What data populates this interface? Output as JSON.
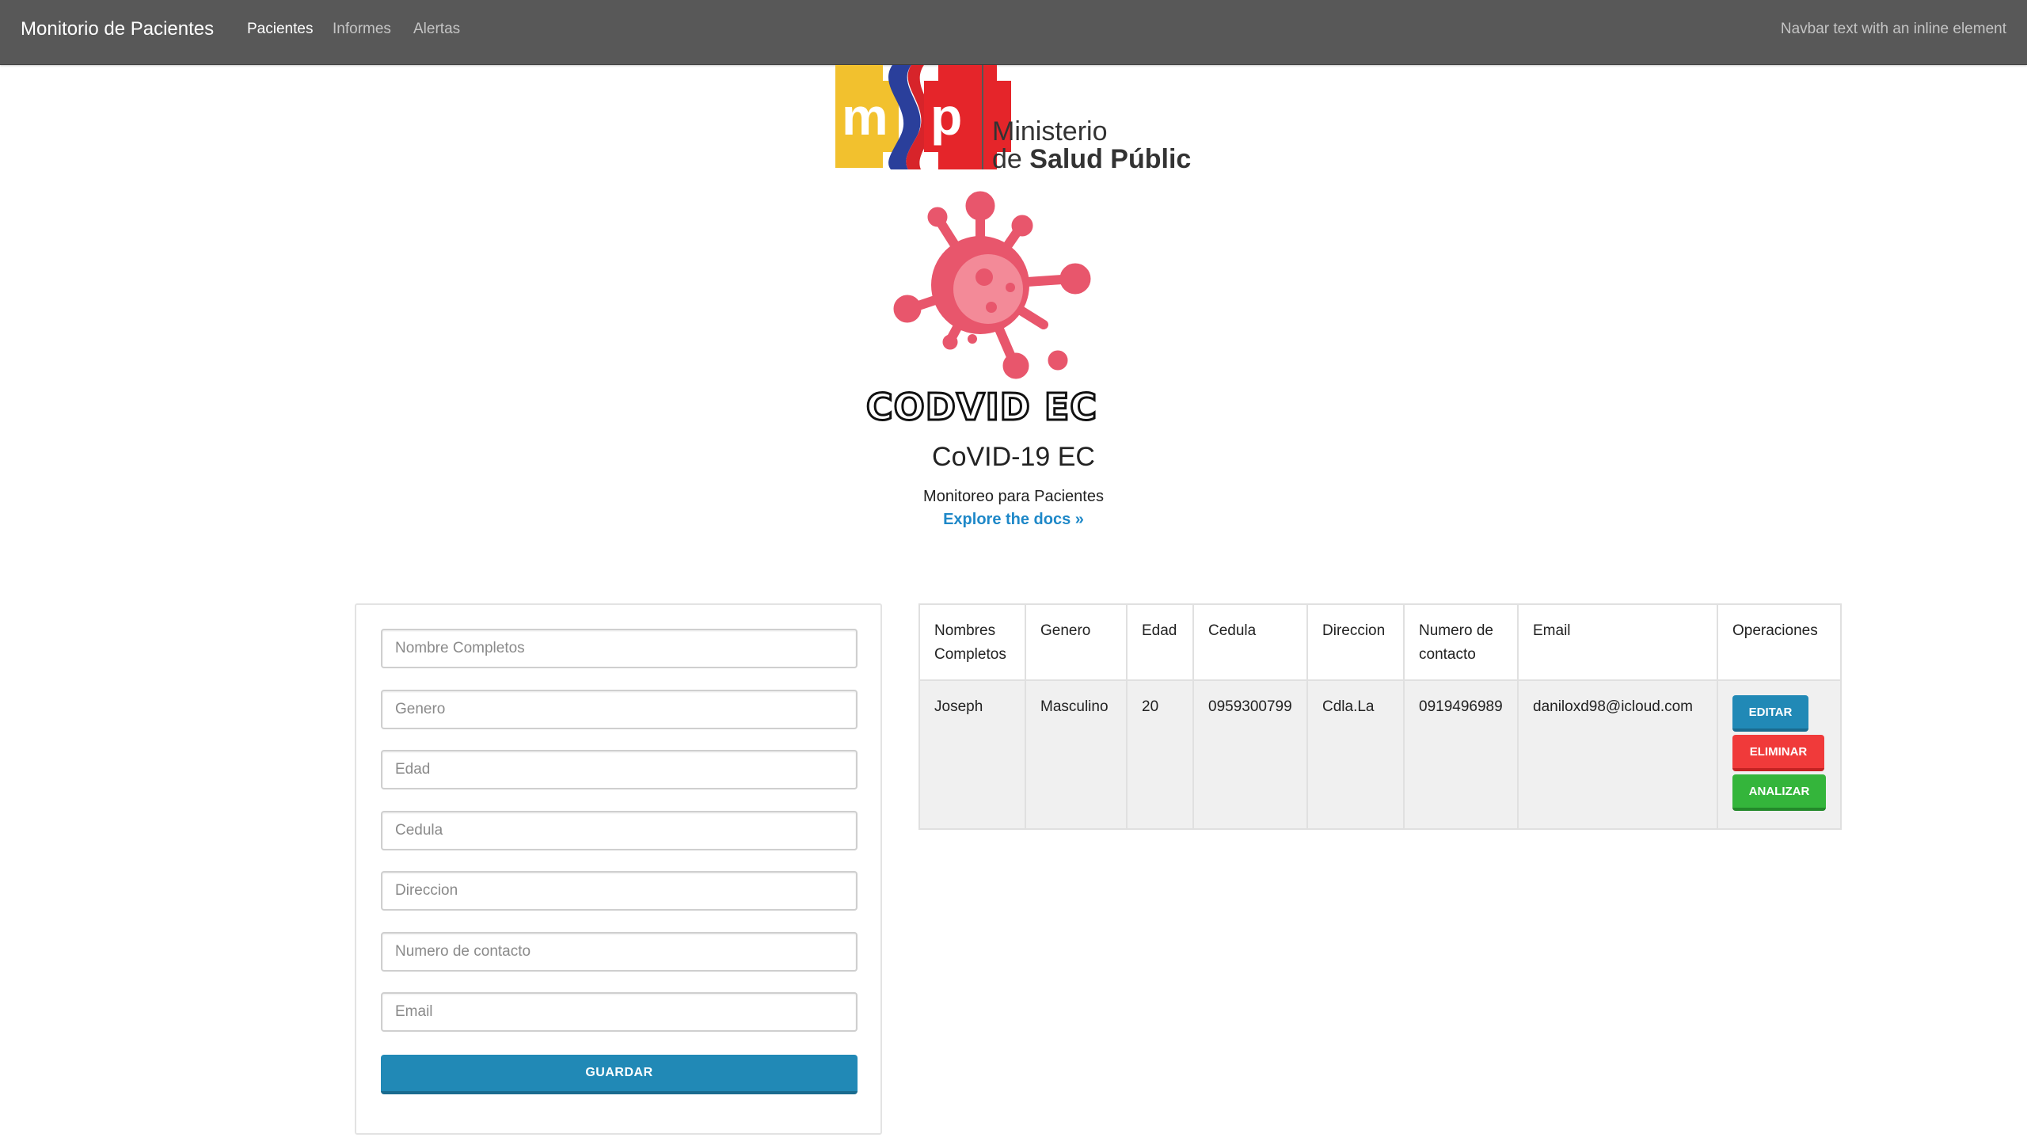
{
  "navbar": {
    "brand": "Monitorio de Pacientes",
    "links": [
      "Pacientes",
      "Informes",
      "Alertas"
    ],
    "active_link": "Pacientes",
    "right_text": "Navbar text with an inline element"
  },
  "logos": {
    "msp_text_line1": "Ministerio",
    "msp_text_line2_prefix": "de ",
    "msp_text_line2_bold": "Salud Pública",
    "msp_initials": "msp",
    "codvid_text": "CODVID EC"
  },
  "hero": {
    "title": "CoVID-19 EC",
    "subtitle": "Monitoreo para Pacientes",
    "link": "Explore the docs »"
  },
  "form": {
    "placeholders": {
      "nombre": "Nombre Completos",
      "genero": "Genero",
      "edad": "Edad",
      "cedula": "Cedula",
      "direccion": "Direccion",
      "numero": "Numero de contacto",
      "email": "Email"
    },
    "save_label": "GUARDAR"
  },
  "table": {
    "headers": {
      "nombres": "Nombres Completos",
      "genero": "Genero",
      "edad": "Edad",
      "cedula": "Cedula",
      "direccion": "Direccion",
      "numero": "Numero de contacto",
      "email": "Email",
      "operaciones": "Operaciones"
    },
    "rows": [
      {
        "nombres": "Joseph",
        "genero": "Masculino",
        "edad": "20",
        "cedula": "0959300799",
        "direccion": "Cdla.La",
        "numero": "0919496989",
        "email": "daniloxd98@icloud.com"
      }
    ],
    "ops": {
      "edit": "EDITAR",
      "delete": "ELIMINAR",
      "analyze": "ANALIZAR"
    }
  },
  "colors": {
    "navbar": "#585858",
    "primary": "#2189b6",
    "danger": "#f03a3a",
    "success": "#34b53b",
    "virus": "#e8566c",
    "link": "#1e88c8"
  }
}
